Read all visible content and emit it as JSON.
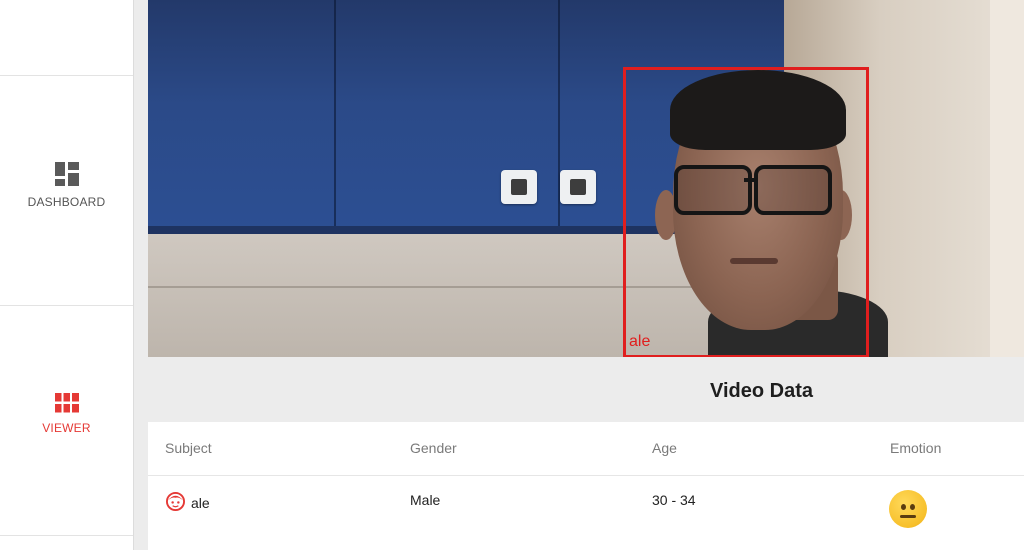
{
  "sidebar": {
    "items": [
      {
        "label": "DASHBOARD",
        "icon": "dashboard-icon",
        "active": false
      },
      {
        "label": "VIEWER",
        "icon": "grid-icon",
        "active": true
      }
    ],
    "active_color": "#e53935"
  },
  "video": {
    "face_label": "ale",
    "box_color": "#e01e1e"
  },
  "data_panel": {
    "title": "Video Data",
    "columns": [
      "Subject",
      "Gender",
      "Age",
      "Emotion"
    ],
    "rows": [
      {
        "subject": "ale",
        "gender": "Male",
        "age": "30 - 34",
        "emotion_icon": "neutral-face-icon"
      }
    ]
  }
}
